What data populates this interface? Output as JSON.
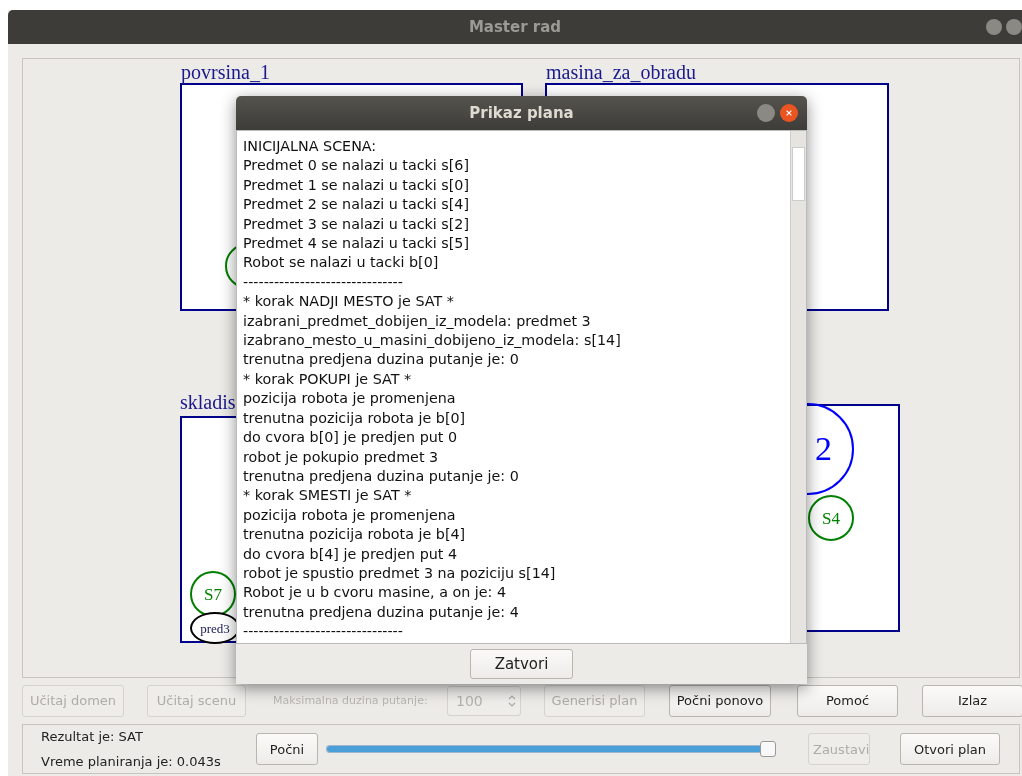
{
  "window": {
    "title": "Master rad"
  },
  "canvas": {
    "regions": [
      {
        "kind": "box",
        "label": "povrsina_1"
      },
      {
        "kind": "box",
        "label": "masina_za_obradu"
      },
      {
        "kind": "box",
        "label": "skladis"
      },
      {
        "kind": "box"
      }
    ],
    "nodes": [
      {
        "kind": "circle",
        "color": "#008000"
      },
      {
        "kind": "circle",
        "label": "S7",
        "color": "#008000"
      },
      {
        "kind": "ellipse",
        "label": "pred3",
        "color": "#000000"
      },
      {
        "kind": "circle",
        "label": "2",
        "color": "#0000ff"
      },
      {
        "kind": "circle",
        "label": "S4",
        "color": "#008000"
      }
    ]
  },
  "dialog": {
    "title": "Prikaz plana",
    "lines": [
      "INICIJALNA SCENA:",
      "Predmet 0 se nalazi u tacki s[6]",
      "Predmet 1 se nalazi u tacki s[0]",
      "Predmet 2 se nalazi u tacki s[4]",
      "Predmet 3 se nalazi u tacki s[2]",
      "Predmet 4 se nalazi u tacki s[5]",
      "Robot se nalazi u tacki b[0]",
      "-------------------------------",
      "* korak NADJI MESTO je SAT *",
      "izabrani_predmet_dobijen_iz_modela: predmet 3",
      "izabrano_mesto_u_masini_dobijeno_iz_modela: s[14]",
      "trenutna predjena duzina putanje je: 0",
      "* korak POKUPI je SAT *",
      "pozicija robota je promenjena",
      "trenutna pozicija robota je b[0]",
      "do cvora b[0] je predjen put 0",
      "robot je pokupio predmet 3",
      "trenutna predjena duzina putanje je: 0",
      "* korak SMESTI je SAT *",
      "pozicija robota je promenjena",
      "trenutna pozicija robota je b[4]",
      "do cvora b[4] je predjen put 4",
      "robot je spustio predmet 3 na poziciju s[14]",
      "Robot je u b cvoru masine, a on je: 4",
      "trenutna predjena duzina putanje je: 4",
      "-------------------------------"
    ],
    "button": "Zatvori"
  },
  "toolbar": [
    {
      "kind": "button",
      "label": "Učitaj domen",
      "disabled": true
    },
    {
      "kind": "button",
      "label": "Učitaj scenu",
      "disabled": true
    },
    {
      "kind": "label",
      "label": "Maksimalna duzina putanje:",
      "disabled": true
    },
    {
      "kind": "spinner",
      "label": "100",
      "disabled": true
    },
    {
      "kind": "button",
      "label": "Generisi plan",
      "disabled": true
    },
    {
      "kind": "button",
      "label": "Počni ponovo",
      "disabled": false
    },
    {
      "kind": "button",
      "label": "Pomoć",
      "disabled": false
    },
    {
      "kind": "button",
      "label": "Izlaz",
      "disabled": false
    }
  ],
  "status": {
    "result": "Rezultat je: SAT",
    "time": "Vreme planiranja je: 0.043s",
    "controls": [
      {
        "kind": "button",
        "label": "Počni",
        "disabled": false
      },
      {
        "kind": "slider",
        "level": 1.0
      },
      {
        "kind": "button",
        "label": "Zaustavi",
        "disabled": true
      },
      {
        "kind": "button",
        "label": "Otvori plan",
        "disabled": false
      }
    ]
  }
}
